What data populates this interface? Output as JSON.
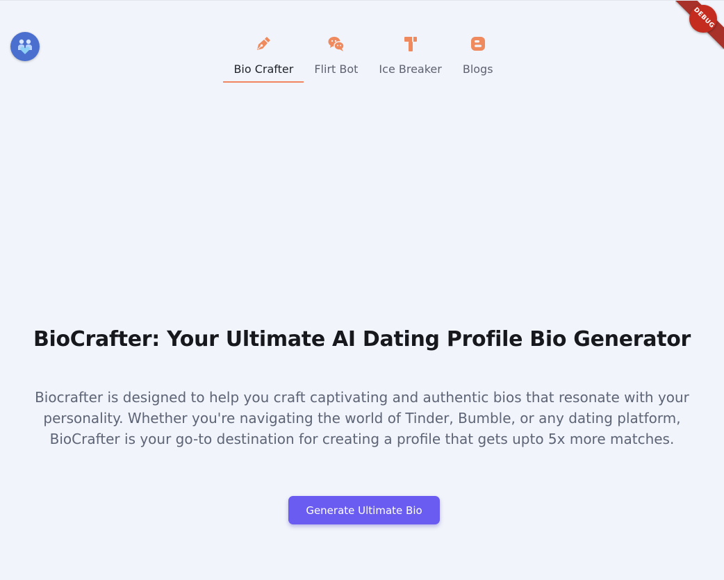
{
  "brand": {
    "logo_icon": "couple-heart-icon",
    "accent_color": "#f08560",
    "button_color": "#6a5cf0"
  },
  "debug": {
    "label": "DEBUG"
  },
  "nav": {
    "items": [
      {
        "label": "Bio Crafter",
        "icon": "pen-nib-icon",
        "active": true
      },
      {
        "label": "Flirt Bot",
        "icon": "chat-bubbles-icon",
        "active": false
      },
      {
        "label": "Ice Breaker",
        "icon": "hammer-icon",
        "active": false
      },
      {
        "label": "Blogs",
        "icon": "blogger-icon",
        "active": false
      }
    ]
  },
  "hero": {
    "title": "BioCrafter: Your Ultimate AI Dating Profile Bio Generator",
    "description": "Biocrafter is designed to help you craft captivating and authentic bios that resonate with your personality. Whether you're navigating the world of Tinder, Bumble, or any dating platform, BioCrafter is your go-to destination for creating a profile that gets upto 5x more matches.",
    "cta_label": "Generate Ultimate Bio"
  }
}
